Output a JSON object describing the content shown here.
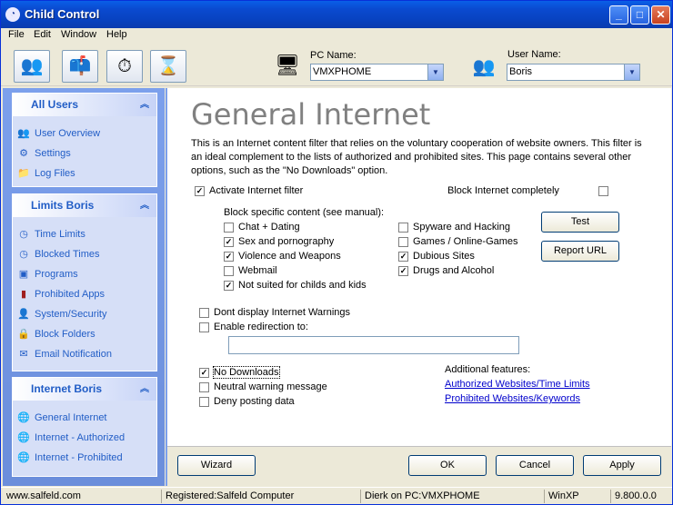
{
  "window": {
    "title": "Child Control",
    "app_icon": "clock-icon"
  },
  "menu": [
    "File",
    "Edit",
    "Window",
    "Help"
  ],
  "toolbar": {
    "icons": [
      "users-icon",
      "mailbox-icon",
      "stopwatch-icon",
      "hourglass-icon"
    ],
    "pc_label": "PC Name:",
    "pc_value": "VMXPHOME",
    "user_label": "User Name:",
    "user_value": "Boris"
  },
  "sidebar": {
    "all_users": {
      "title": "All Users",
      "items": [
        {
          "label": "User Overview",
          "icon": "users-icon"
        },
        {
          "label": "Settings",
          "icon": "settings-icon"
        },
        {
          "label": "Log Files",
          "icon": "folder-icon"
        }
      ]
    },
    "limits": {
      "title": "Limits Boris",
      "items": [
        {
          "label": "Time Limits",
          "icon": "clock-icon"
        },
        {
          "label": "Blocked Times",
          "icon": "clock-icon"
        },
        {
          "label": "Programs",
          "icon": "programs-icon"
        },
        {
          "label": "Prohibited Apps",
          "icon": "app-icon"
        },
        {
          "label": "System/Security",
          "icon": "security-icon"
        },
        {
          "label": "Block Folders",
          "icon": "lock-icon"
        },
        {
          "label": "Email Notification",
          "icon": "email-icon"
        }
      ]
    },
    "internet": {
      "title": "Internet Boris",
      "items": [
        {
          "label": "General Internet",
          "icon": "globe-icon"
        },
        {
          "label": "Internet - Authorized",
          "icon": "globe-icon"
        },
        {
          "label": "Internet - Prohibited",
          "icon": "globe-icon"
        }
      ]
    }
  },
  "main": {
    "heading": "General Internet",
    "description": "This is an Internet content filter that relies on the voluntary cooperation of website owners. This filter is an ideal complement to the lists of authorized and prohibited sites. This page contains several other options, such as the \"No Downloads\" option.",
    "activate_filter": {
      "label": "Activate Internet filter",
      "checked": true
    },
    "block_completely": {
      "label": "Block Internet completely",
      "checked": false
    },
    "block_specific_label": "Block specific content (see manual):",
    "categories_left": [
      {
        "label": "Chat + Dating",
        "checked": false
      },
      {
        "label": "Sex and pornography",
        "checked": true
      },
      {
        "label": "Violence and Weapons",
        "checked": true
      },
      {
        "label": "Webmail",
        "checked": false
      },
      {
        "label": "Not suited for childs and kids",
        "checked": true
      }
    ],
    "categories_right": [
      {
        "label": "Spyware and Hacking",
        "checked": false
      },
      {
        "label": "Games / Online-Games",
        "checked": false
      },
      {
        "label": "Dubious Sites",
        "checked": true
      },
      {
        "label": "Drugs and Alcohol",
        "checked": true
      }
    ],
    "test_button": "Test",
    "report_button": "Report URL",
    "dont_display_warnings": {
      "label": "Dont display Internet Warnings",
      "checked": false
    },
    "enable_redirection": {
      "label": "Enable redirection to:",
      "checked": false
    },
    "redirect_value": "",
    "no_downloads": {
      "label": "No Downloads",
      "checked": true
    },
    "neutral_warning": {
      "label": "Neutral warning message",
      "checked": false
    },
    "deny_posting": {
      "label": "Deny posting data",
      "checked": false
    },
    "additional_label": "Additional features:",
    "link_authorized": "Authorized Websites/Time Limits",
    "link_prohibited": "Prohibited Websites/Keywords",
    "wizard_button": "Wizard",
    "ok_button": "OK",
    "cancel_button": "Cancel",
    "apply_button": "Apply"
  },
  "status": {
    "site": "www.salfeld.com",
    "registered": "Registered:Salfeld Computer",
    "user_pc": "Dierk on PC:VMXPHOME",
    "os": "WinXP",
    "version": "9.800.0.0"
  }
}
